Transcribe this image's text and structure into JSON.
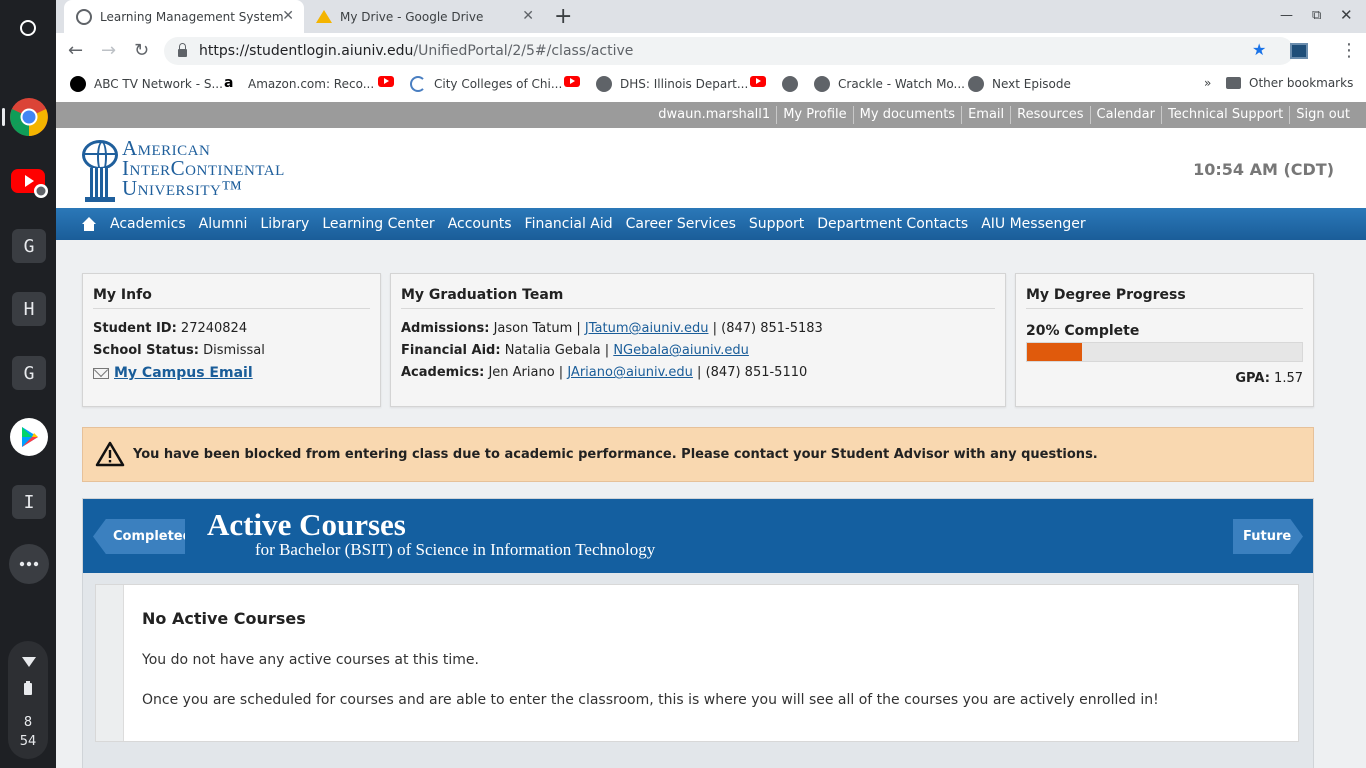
{
  "shelf": {
    "apps": [
      {
        "name": "chrome"
      },
      {
        "name": "youtube"
      },
      {
        "letter": "G"
      },
      {
        "letter": "H"
      },
      {
        "letter": "G"
      },
      {
        "name": "play-store"
      },
      {
        "letter": "I"
      }
    ],
    "time_hour": "8",
    "time_min": "54"
  },
  "browser": {
    "tabs": [
      {
        "title": "Learning Management System",
        "active": true
      },
      {
        "title": "My Drive - Google Drive",
        "active": false
      }
    ],
    "url_host": "https://studentlogin.aiuniv.edu",
    "url_path": "/UnifiedPortal/2/5#/class/active",
    "bookmarks": [
      "ABC TV Network - S...",
      "Amazon.com: Reco...",
      "City Colleges of Chi...",
      "DHS: Illinois Depart...",
      "Crackle - Watch Mo...",
      "Next Episode"
    ],
    "other_bookmarks": "Other bookmarks",
    "overflow": "»"
  },
  "topbar": {
    "links": [
      "dwaun.marshall1",
      "My Profile",
      "My documents",
      "Email",
      "Resources",
      "Calendar",
      "Technical Support",
      "Sign out"
    ]
  },
  "header": {
    "logo_line1": "American",
    "logo_line2": "InterContinental",
    "logo_line3": "University™",
    "clock": "10:54 AM (CDT)"
  },
  "nav": {
    "items": [
      "Academics",
      "Alumni",
      "Library",
      "Learning Center",
      "Accounts",
      "Financial Aid",
      "Career Services",
      "Support",
      "Department Contacts",
      "AIU Messenger"
    ]
  },
  "my_info": {
    "title": "My Info",
    "student_id_label": "Student ID:",
    "student_id": "27240824",
    "status_label": "School Status:",
    "status": "Dismissal",
    "email_link": "My Campus Email"
  },
  "grad_team": {
    "title": "My Graduation Team",
    "rows": [
      {
        "label": "Admissions:",
        "name": "Jason Tatum",
        "email": "JTatum@aiuniv.edu",
        "phone": "(847) 851-5183"
      },
      {
        "label": "Financial Aid:",
        "name": "Natalia Gebala",
        "email": "NGebala@aiuniv.edu",
        "phone": ""
      },
      {
        "label": "Academics:",
        "name": "Jen Ariano",
        "email": "JAriano@aiuniv.edu",
        "phone": "(847) 851-5110"
      }
    ]
  },
  "degree": {
    "title": "My Degree Progress",
    "complete_label": "20% Complete",
    "progress": 0.2,
    "gpa_label": "GPA:",
    "gpa": "1.57",
    "fill_color": "#e05a0c"
  },
  "alert": {
    "message": "You have been blocked from entering class due to academic performance. Please contact your Student Advisor with any questions."
  },
  "courses": {
    "prev": "Completed",
    "next": "Future",
    "title": "Active Courses",
    "subtitle": "for Bachelor (BSIT) of Science in Information Technology",
    "empty_title": "No Active Courses",
    "empty_line1": "You do not have any active courses at this time.",
    "empty_line2": "Once you are scheduled for courses and are able to enter the classroom, this is where you will see all of the courses you are actively enrolled in!"
  },
  "colors": {
    "nav_blue": "#1a5d99",
    "course_header": "#145fa0",
    "alert_bg": "#f9d8b0"
  }
}
